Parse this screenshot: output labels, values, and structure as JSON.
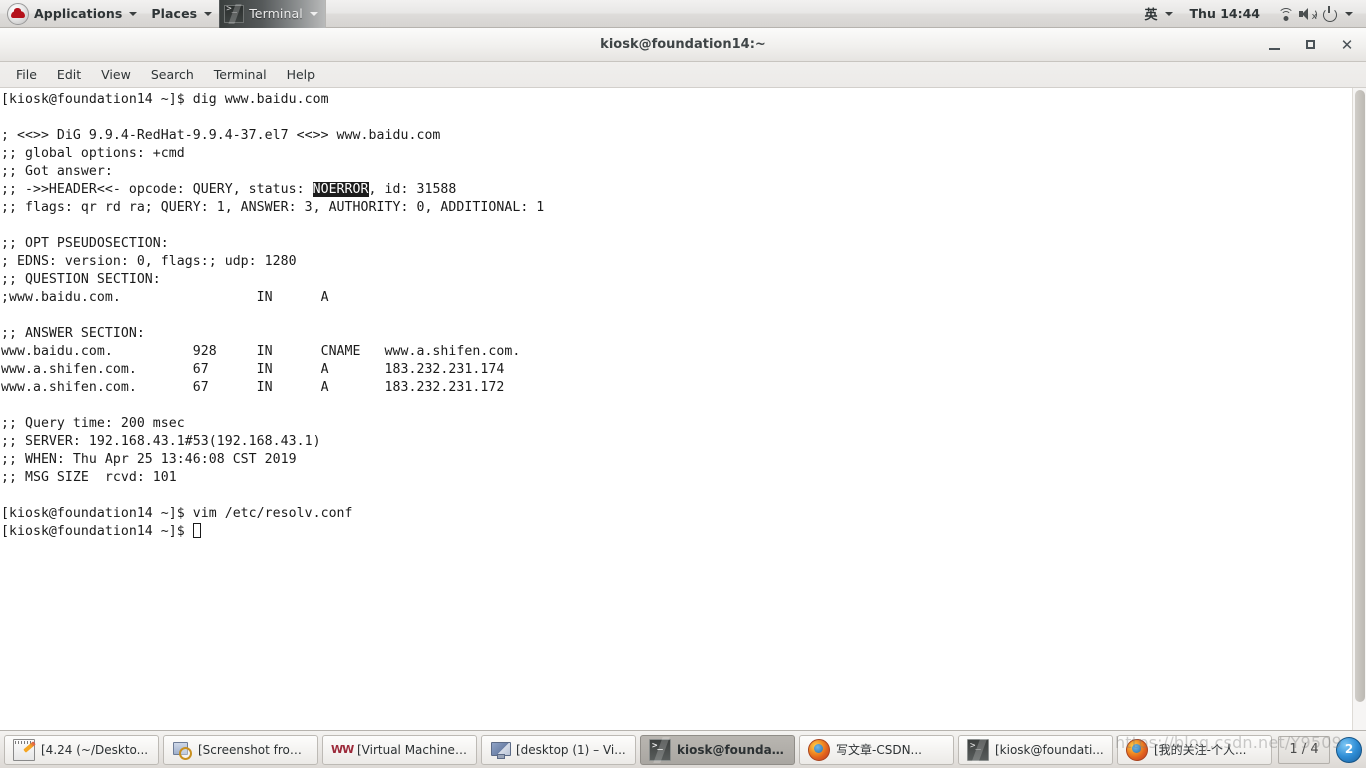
{
  "top_panel": {
    "logo_icon": "redhat-logo-icon",
    "applications_label": "Applications",
    "places_label": "Places",
    "terminal_label": "Terminal",
    "terminal_icon": "terminal-icon",
    "ime_label": "英",
    "clock": "Thu 14:44",
    "wifi_icon": "wifi-icon",
    "volume_icon": "volume-muted-icon",
    "power_icon": "power-icon",
    "dropdown_icon": "chevron-down-icon"
  },
  "window": {
    "title": "kiosk@foundation14:~",
    "minimize_label": "",
    "maximize_label": "",
    "close_label": "✕",
    "menus": [
      {
        "label": "File"
      },
      {
        "label": "Edit"
      },
      {
        "label": "View"
      },
      {
        "label": "Search"
      },
      {
        "label": "Terminal"
      },
      {
        "label": "Help"
      }
    ]
  },
  "terminal": {
    "lines": {
      "l01": "[kiosk@foundation14 ~]$ dig www.baidu.com",
      "l02": "",
      "l03": "; <<>> DiG 9.9.4-RedHat-9.9.4-37.el7 <<>> www.baidu.com",
      "l04": ";; global options: +cmd",
      "l05": ";; Got answer:",
      "l06a": ";; ->>HEADER<<- opcode: QUERY, status: ",
      "l06b": "NOERROR",
      "l06c": ", id: 31588",
      "l07": ";; flags: qr rd ra; QUERY: 1, ANSWER: 3, AUTHORITY: 0, ADDITIONAL: 1",
      "l08": "",
      "l09": ";; OPT PSEUDOSECTION:",
      "l10": "; EDNS: version: 0, flags:; udp: 1280",
      "l11": ";; QUESTION SECTION:",
      "l12": ";www.baidu.com.                 IN      A",
      "l13": "",
      "l14": ";; ANSWER SECTION:",
      "l15": "www.baidu.com.          928     IN      CNAME   www.a.shifen.com.",
      "l16": "www.a.shifen.com.       67      IN      A       183.232.231.174",
      "l17": "www.a.shifen.com.       67      IN      A       183.232.231.172",
      "l18": "",
      "l19": ";; Query time: 200 msec",
      "l20": ";; SERVER: 192.168.43.1#53(192.168.43.1)",
      "l21": ";; WHEN: Thu Apr 25 13:46:08 CST 2019",
      "l22": ";; MSG SIZE  rcvd: 101",
      "l23": "",
      "l24": "[kiosk@foundation14 ~]$ vim /etc/resolv.conf",
      "l25": "[kiosk@foundation14 ~]$ "
    }
  },
  "taskbar": {
    "tasks": [
      {
        "label": "[4.24 (~/Deskto...",
        "icon": "notepad-icon",
        "active": false
      },
      {
        "label": "[Screenshot from...",
        "icon": "screenshot-icon",
        "active": false
      },
      {
        "label": "[Virtual Machine ...",
        "icon": "vmware-icon",
        "active": false
      },
      {
        "label": "[desktop (1) – Vi...",
        "icon": "monitor-icon",
        "active": false
      },
      {
        "label": "kiosk@foundatio...",
        "icon": "terminal-icon",
        "active": true
      },
      {
        "label": "写文章-CSDN...",
        "icon": "firefox-icon",
        "active": false
      },
      {
        "label": "[kiosk@foundati...",
        "icon": "terminal-icon",
        "active": false
      },
      {
        "label": "[我的关注-个人...",
        "icon": "firefox-icon",
        "active": false
      }
    ],
    "workspace": "1 / 4",
    "tray_icon": "blue-badge-icon"
  },
  "overlay": {
    "watermark": "https://blog.csdn.net/Y9509"
  },
  "colors": {
    "panel_bg": "#e8e7e6",
    "terminal_bg": "#ffffff",
    "terminal_fg": "#1a1a1a",
    "highlight_bg": "#1c1c1c",
    "highlight_fg": "#ffffff",
    "active_task_bg": "#b0ada8"
  }
}
